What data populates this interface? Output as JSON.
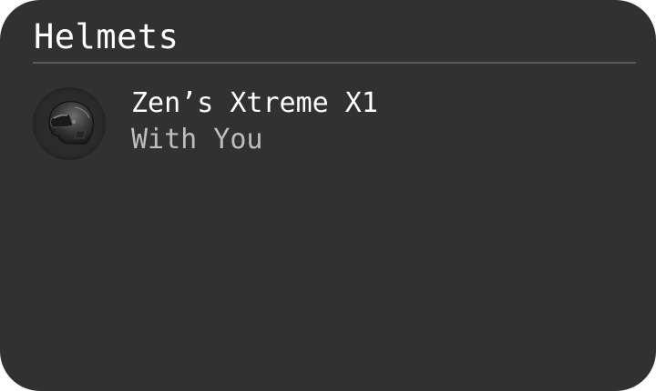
{
  "panel": {
    "title": "Helmets"
  },
  "items": [
    {
      "title": "Zen’s Xtreme X1",
      "subtitle": "With You",
      "icon": "helmet-icon"
    }
  ],
  "colors": {
    "panel_background": "#313131",
    "title_text": "#ffffff",
    "subtitle_text": "#bdbdbd",
    "divider": "#595959"
  }
}
